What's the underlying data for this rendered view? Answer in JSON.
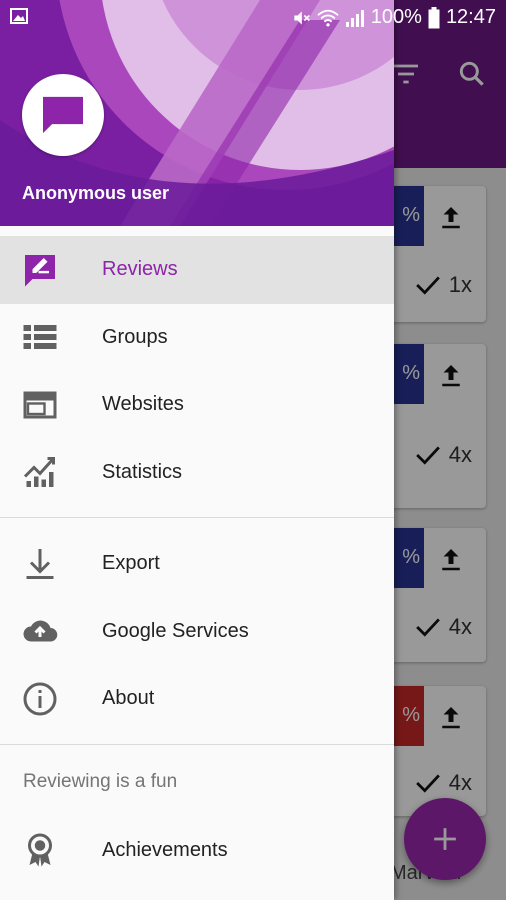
{
  "status_bar": {
    "battery": "100%",
    "time": "12:47",
    "icons": [
      "gallery-icon",
      "mute-icon",
      "wifi-icon",
      "signal-icon",
      "battery-icon"
    ]
  },
  "drawer": {
    "user_name": "Anonymous user",
    "primary_items": [
      {
        "label": "Reviews",
        "icon": "rate-review-icon",
        "active": true
      },
      {
        "label": "Groups",
        "icon": "list-icon"
      },
      {
        "label": "Websites",
        "icon": "web-icon"
      },
      {
        "label": "Statistics",
        "icon": "chart-icon"
      }
    ],
    "secondary_items": [
      {
        "label": "Export",
        "icon": "download-icon"
      },
      {
        "label": "Google Services",
        "icon": "cloud-upload-icon"
      },
      {
        "label": "About",
        "icon": "info-icon"
      }
    ],
    "subheader": "Reviewing is a fun",
    "tertiary_items": [
      {
        "label": "Achievements",
        "icon": "award-icon"
      }
    ]
  },
  "background": {
    "toolbar_icons": [
      "filter-icon",
      "search-icon"
    ],
    "cards": [
      {
        "badge": "%",
        "badge_color": "#283593",
        "count": "1x"
      },
      {
        "badge": "%",
        "badge_color": "#283593",
        "count": "4x"
      },
      {
        "badge": "%",
        "badge_color": "#283593",
        "count": "4x"
      },
      {
        "badge": "%",
        "badge_color": "#c62828",
        "count": "4x"
      }
    ],
    "partial_title": "Marveld"
  },
  "colors": {
    "primary": "#7b1fa2",
    "accent": "#9c27b0",
    "active_text": "#8e24aa"
  }
}
